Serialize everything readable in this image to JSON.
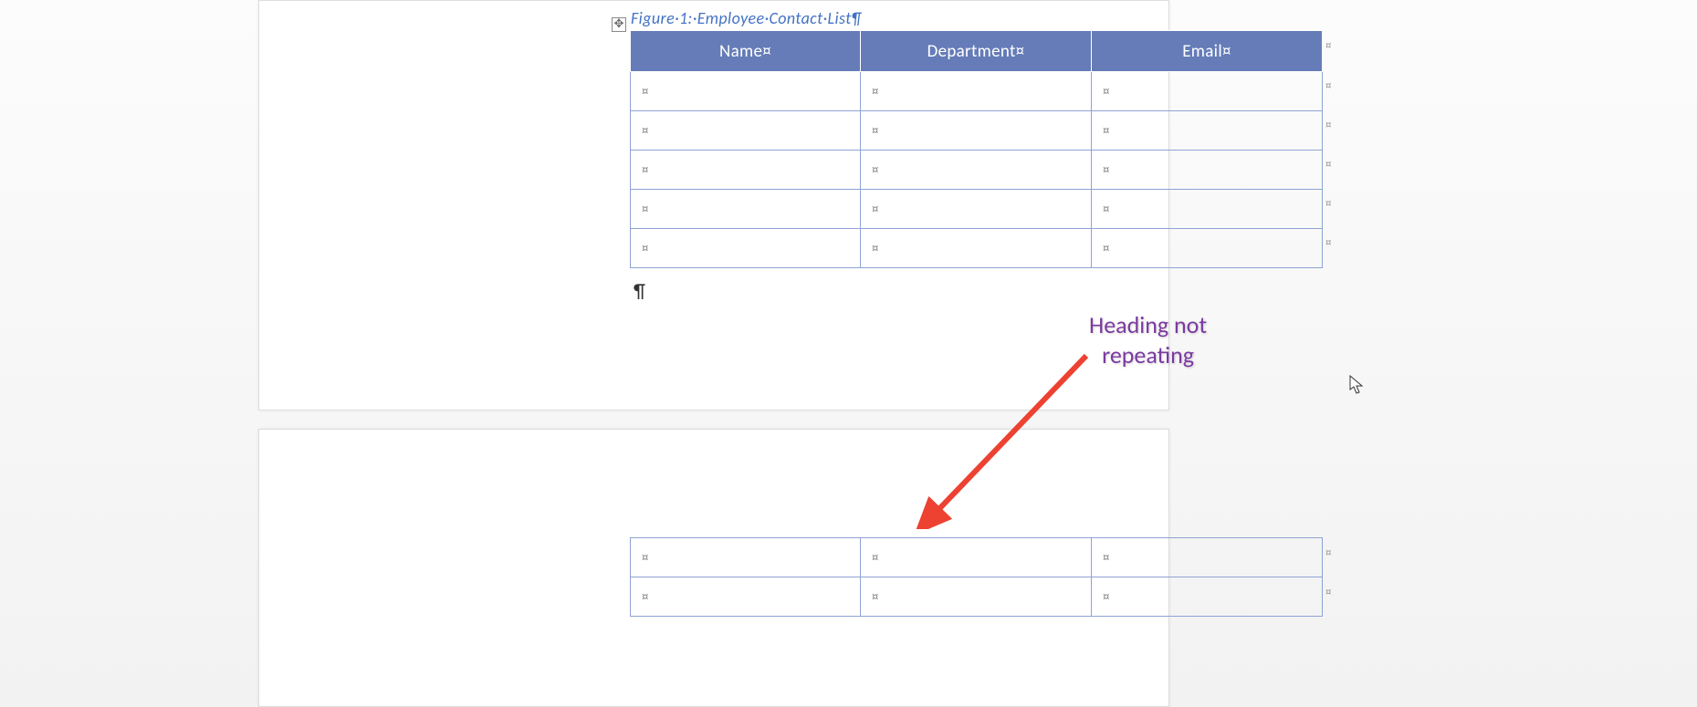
{
  "caption": "Figure·1:·Employee·Contact·List¶",
  "table_anchor_glyph": "✥",
  "table1": {
    "headers": [
      "Name¤",
      "Department¤",
      "Email¤"
    ],
    "rows": [
      [
        "¤",
        "¤",
        "¤"
      ],
      [
        "¤",
        "¤",
        "¤"
      ],
      [
        "¤",
        "¤",
        "¤"
      ],
      [
        "¤",
        "¤",
        "¤"
      ],
      [
        "¤",
        "¤",
        "¤"
      ]
    ]
  },
  "table2": {
    "rows": [
      [
        "¤",
        "¤",
        "¤"
      ],
      [
        "¤",
        "¤",
        "¤"
      ]
    ]
  },
  "row_end_mark": "¤",
  "paragraph_mark": "¶",
  "annotation": "Heading not\nrepeating",
  "colors": {
    "header_bg": "#657cb8",
    "border": "#8ea3d4",
    "caption": "#4472c4",
    "annotation": "#7b3aa0",
    "arrow": "#ed4132"
  }
}
